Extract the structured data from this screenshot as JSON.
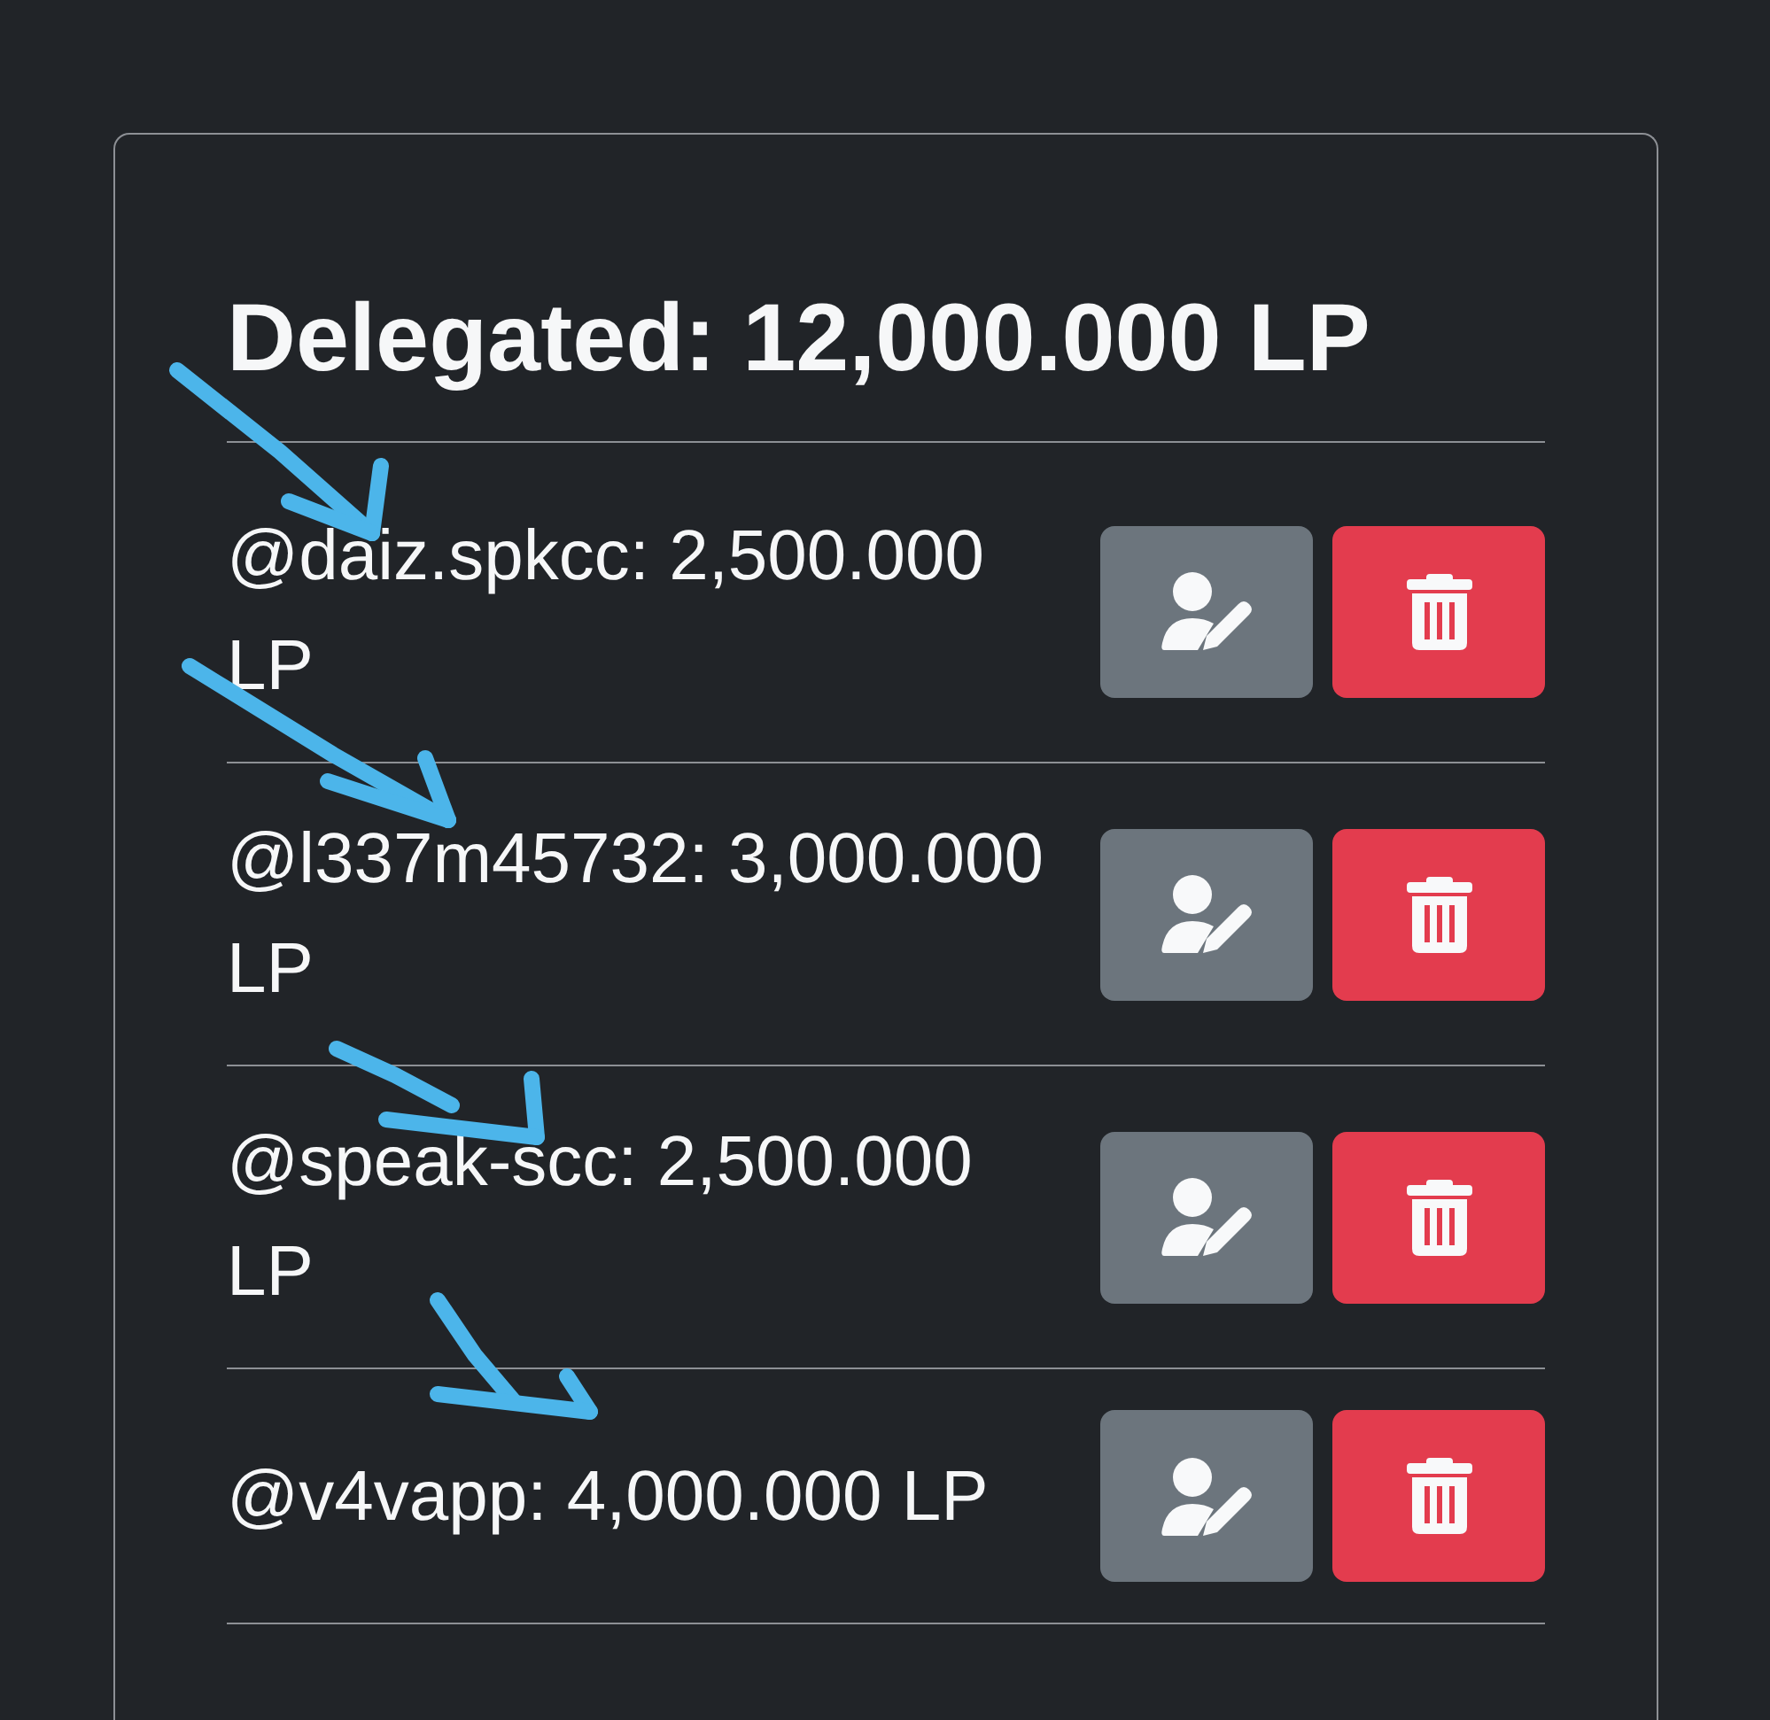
{
  "card": {
    "title": "Delegated: 12,000.000 LP"
  },
  "delegations": [
    {
      "label": "@daiz.spkcc: 2,500.000 LP",
      "marked": true
    },
    {
      "label": "@l337m45732: 3,000.000 LP",
      "marked": true
    },
    {
      "label": "@speak-scc: 2,500.000 LP",
      "marked": true
    },
    {
      "label": "@v4vapp: 4,000.000 LP",
      "marked": true
    }
  ]
}
